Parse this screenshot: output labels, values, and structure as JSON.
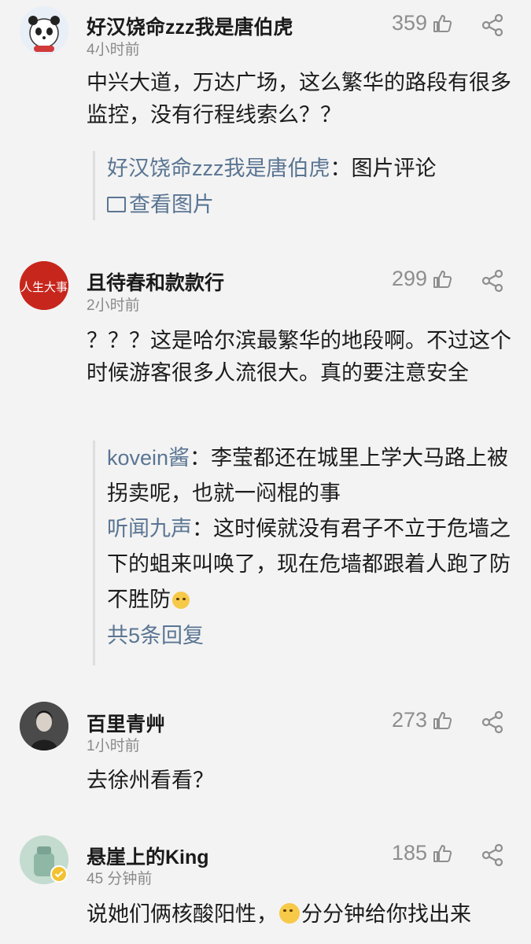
{
  "comments": [
    {
      "username": "好汉饶命zzz我是唐伯虎",
      "time": "4小时前",
      "likes": "359",
      "text": "中兴大道，万达广场，这么繁华的路段有很多监控，没有行程线索么？？",
      "reply_author": "好汉饶命zzz我是唐伯虎",
      "reply_text": "：图片评论",
      "view_image": "查看图片"
    },
    {
      "username": "且待春和款款行",
      "time": "2小时前",
      "likes": "299",
      "text": "？？？这是哈尔滨最繁华的地段啊。不过这个时候游客很多人流很大。真的要注意安全",
      "avatar_text": "人生大事",
      "replies": [
        {
          "author": "kovein酱",
          "text": "：李莹都还在城里上学大马路上被拐卖呢，也就一闷棍的事"
        },
        {
          "author": "听闻九声",
          "text": "：这时候就没有君子不立于危墙之下的蛆来叫唤了，现在危墙都跟着人跑了防不胜防"
        }
      ],
      "more_replies": "共5条回复"
    },
    {
      "username": "百里青艸",
      "time": "1小时前",
      "likes": "273",
      "text": "去徐州看看？"
    },
    {
      "username": "悬崖上的King",
      "time": "45 分钟前",
      "likes": "185",
      "text_before": "说她们俩核酸阳性，",
      "text_after": "分分钟给你找出来"
    }
  ],
  "colors": {
    "background": "#f3f3f3",
    "link": "#5a7593",
    "meta": "#8a8a8a"
  },
  "icons": [
    "thumbs-up-icon",
    "share-icon",
    "image-icon",
    "emoji-icon"
  ]
}
